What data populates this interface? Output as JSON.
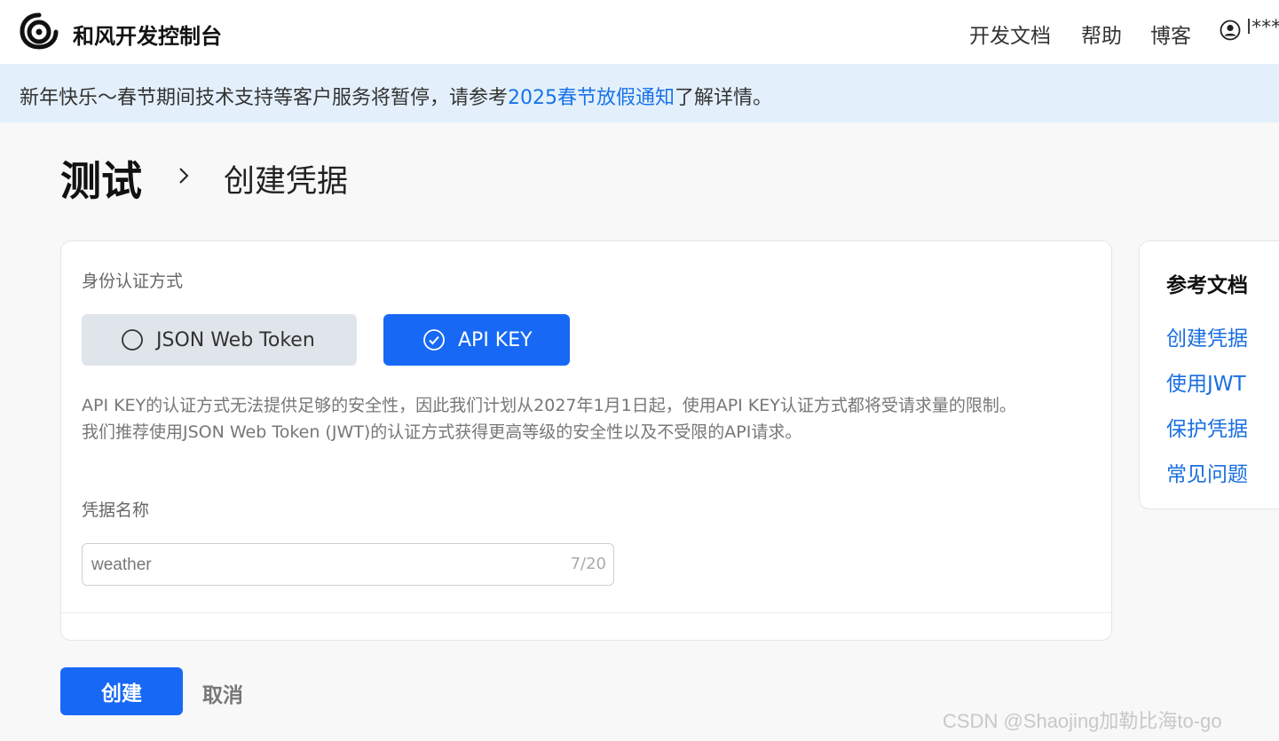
{
  "header": {
    "brand": "和风开发控制台",
    "nav": [
      {
        "label": "开发文档"
      },
      {
        "label": "帮助"
      },
      {
        "label": "博客"
      }
    ],
    "user": "l***"
  },
  "notice": {
    "before": "新年快乐～春节期间技术支持等客户服务将暂停，请参考",
    "link": "2025春节放假通知",
    "after": "了解详情。"
  },
  "breadcrumb": {
    "root": "测试",
    "current": "创建凭据"
  },
  "form": {
    "auth_label": "身份认证方式",
    "options": [
      {
        "label": "JSON Web Token",
        "selected": false
      },
      {
        "label": "API KEY",
        "selected": true
      }
    ],
    "description": [
      "API KEY的认证方式无法提供足够的安全性，因此我们计划从2027年1月1日起，使用API KEY认证方式都将受请求量的限制。",
      "我们推荐使用JSON Web Token (JWT)的认证方式获得更高等级的安全性以及不受限的API请求。"
    ],
    "name_label": "凭据名称",
    "name_value": "weather",
    "name_counter": "7/20"
  },
  "actions": {
    "create": "创建",
    "cancel": "取消"
  },
  "sidebar": {
    "title": "参考文档",
    "links": [
      {
        "label": "创建凭据"
      },
      {
        "label": "使用JWT"
      },
      {
        "label": "保护凭据"
      },
      {
        "label": "常见问题"
      }
    ]
  },
  "watermark": "CSDN @Shaojing加勒比海to-go",
  "colors": {
    "accent": "#1769f5",
    "link": "#1a73e8",
    "notice_bg": "#e3f0fb"
  }
}
